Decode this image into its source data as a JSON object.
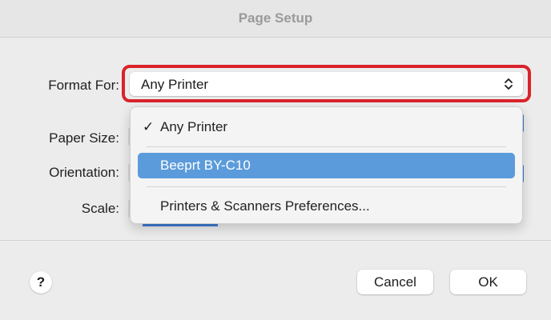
{
  "window": {
    "title": "Page Setup"
  },
  "form": {
    "format_for_label": "Format For:",
    "paper_size_label": "Paper Size:",
    "orientation_label": "Orientation:",
    "scale_label": "Scale:",
    "format_for_value": "Any Printer"
  },
  "dropdown": {
    "checkmark": "✓",
    "items": [
      {
        "label": "Any Printer",
        "checked": true,
        "highlighted": false
      },
      {
        "label": "Beeprt BY-C10",
        "checked": false,
        "highlighted": true
      },
      {
        "label": "Printers & Scanners Preferences...",
        "checked": false,
        "highlighted": false
      }
    ]
  },
  "buttons": {
    "help": "?",
    "cancel": "Cancel",
    "ok": "OK"
  },
  "colors": {
    "focus_ring": "#d9232a",
    "highlight": "#5b9bdb",
    "accent": "#3c7bd2"
  },
  "icons": {
    "select_arrows": "chevron-up-down-icon",
    "check": "checkmark-icon"
  }
}
